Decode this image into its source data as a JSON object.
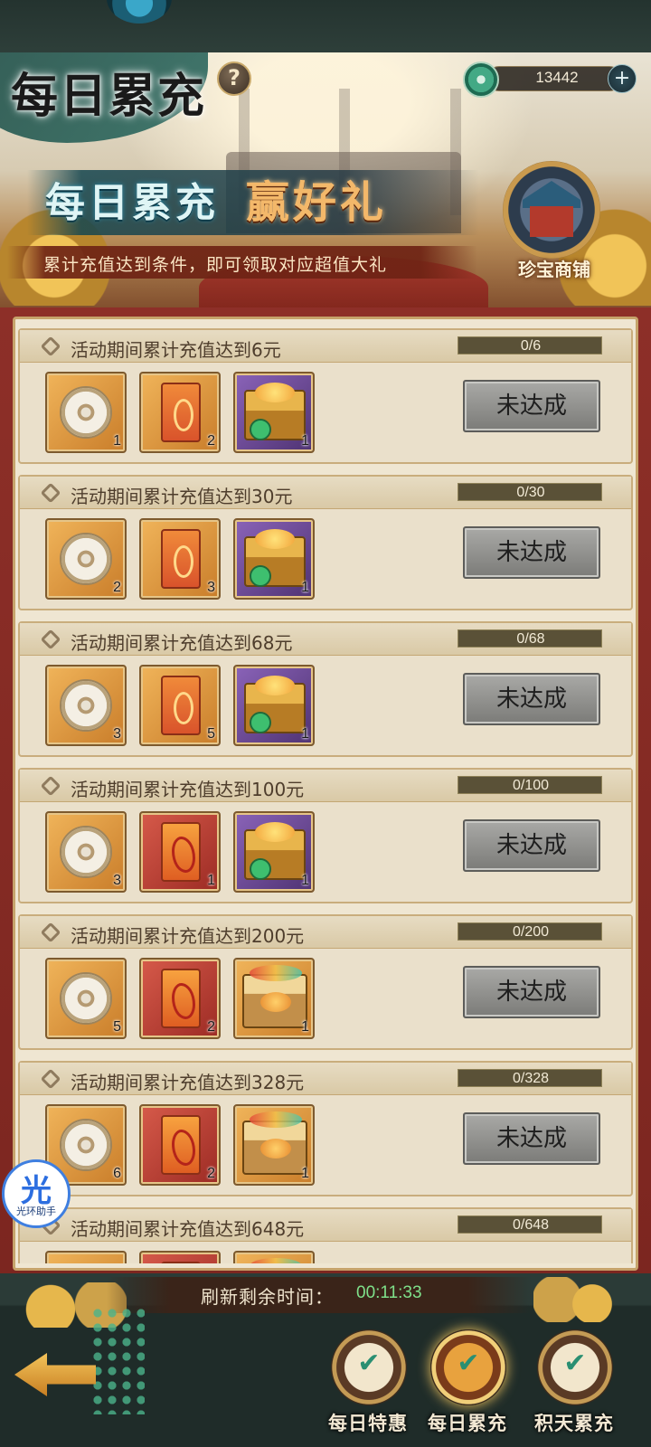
{
  "header": {
    "title": "每日累充",
    "help_icon": "?",
    "currency": {
      "icon": "jade-dragon-coin-icon",
      "amount": "13442",
      "plus_icon": "+"
    }
  },
  "banner": {
    "slogan_a": "每日累充",
    "slogan_b": "赢好礼",
    "subtitle": "累计充值达到条件，即可领取对应超值大礼",
    "shop_label": "珍宝商铺"
  },
  "tasks": [
    {
      "requirement": "活动期间累计充值达到6元",
      "progress": "0/6",
      "progress_fraction": 0,
      "rewards": [
        {
          "icon": "coin",
          "frame": "orange",
          "qty": "1"
        },
        {
          "icon": "envelope",
          "frame": "orange",
          "qty": "2"
        },
        {
          "icon": "chest",
          "frame": "purple",
          "qty": "1"
        }
      ],
      "button": "未达成"
    },
    {
      "requirement": "活动期间累计充值达到30元",
      "progress": "0/30",
      "progress_fraction": 0,
      "rewards": [
        {
          "icon": "coin",
          "frame": "orange",
          "qty": "2"
        },
        {
          "icon": "envelope",
          "frame": "orange",
          "qty": "3"
        },
        {
          "icon": "chest",
          "frame": "purple",
          "qty": "1"
        }
      ],
      "button": "未达成"
    },
    {
      "requirement": "活动期间累计充值达到68元",
      "progress": "0/68",
      "progress_fraction": 0,
      "rewards": [
        {
          "icon": "coin",
          "frame": "orange",
          "qty": "3"
        },
        {
          "icon": "envelope",
          "frame": "orange",
          "qty": "5"
        },
        {
          "icon": "chest",
          "frame": "purple",
          "qty": "1"
        }
      ],
      "button": "未达成"
    },
    {
      "requirement": "活动期间累计充值达到100元",
      "progress": "0/100",
      "progress_fraction": 0,
      "rewards": [
        {
          "icon": "coin",
          "frame": "orange",
          "qty": "3"
        },
        {
          "icon": "envelope-red",
          "frame": "red",
          "qty": "1"
        },
        {
          "icon": "chest",
          "frame": "purple",
          "qty": "1"
        }
      ],
      "button": "未达成"
    },
    {
      "requirement": "活动期间累计充值达到200元",
      "progress": "0/200",
      "progress_fraction": 0,
      "rewards": [
        {
          "icon": "coin",
          "frame": "orange",
          "qty": "5"
        },
        {
          "icon": "envelope-red",
          "frame": "red",
          "qty": "2"
        },
        {
          "icon": "chest2",
          "frame": "orange",
          "qty": "1"
        }
      ],
      "button": "未达成"
    },
    {
      "requirement": "活动期间累计充值达到328元",
      "progress": "0/328",
      "progress_fraction": 0,
      "rewards": [
        {
          "icon": "coin",
          "frame": "orange",
          "qty": "6"
        },
        {
          "icon": "envelope-red",
          "frame": "red",
          "qty": "2"
        },
        {
          "icon": "chest2",
          "frame": "orange",
          "qty": "1"
        }
      ],
      "button": "未达成"
    },
    {
      "requirement": "活动期间累计充值达到648元",
      "progress": "0/648",
      "progress_fraction": 0,
      "rewards": [
        {
          "icon": "coin",
          "frame": "orange",
          "qty": ""
        },
        {
          "icon": "envelope-red",
          "frame": "red",
          "qty": ""
        },
        {
          "icon": "chest2",
          "frame": "orange",
          "qty": ""
        }
      ],
      "button": ""
    }
  ],
  "assistant": {
    "glyph": "光",
    "caption": "光环助手"
  },
  "footer": {
    "timer_label": "刷新剩余时间：",
    "timer_value": "00:11:33",
    "tabs": [
      {
        "label": "每日特惠",
        "icon": "daily-deal-icon",
        "active": false
      },
      {
        "label": "每日累充",
        "icon": "daily-recharge-icon",
        "active": true
      },
      {
        "label": "积天累充",
        "icon": "accumulated-days-icon",
        "active": false
      }
    ]
  },
  "colors": {
    "frame_red": "#8d2f28",
    "card_bg": "#eae0cb",
    "timer_green": "#7fe08a",
    "button_gray": "#a9a9a6"
  }
}
